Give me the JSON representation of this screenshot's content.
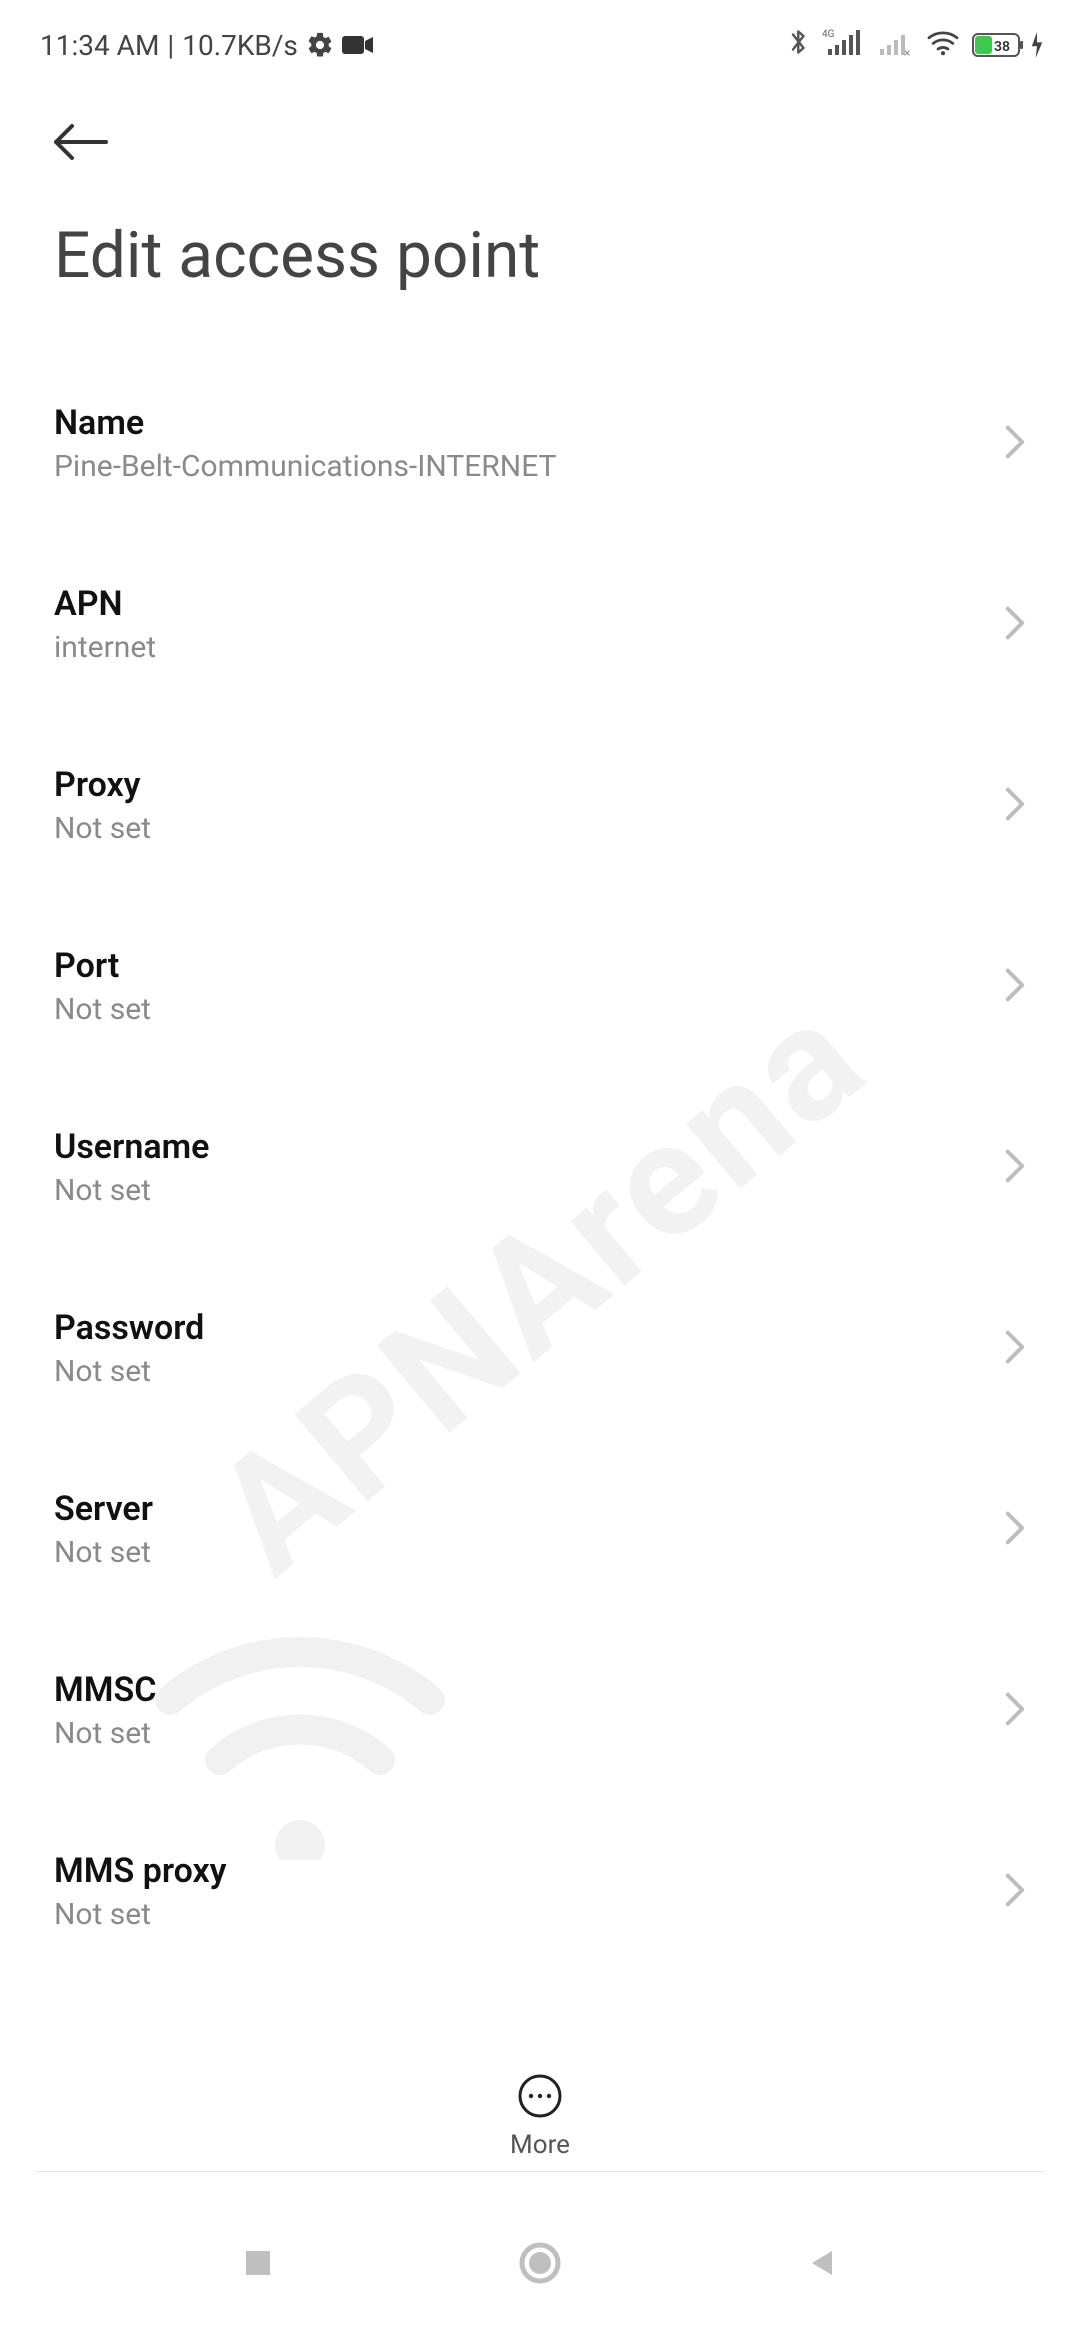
{
  "status": {
    "time": "11:34 AM",
    "speed": "10.7KB/s",
    "network_type": "4G",
    "battery_percent": "38"
  },
  "page": {
    "title": "Edit access point"
  },
  "settings": [
    {
      "label": "Name",
      "value": "Pine-Belt-Communications-INTERNET"
    },
    {
      "label": "APN",
      "value": "internet"
    },
    {
      "label": "Proxy",
      "value": "Not set"
    },
    {
      "label": "Port",
      "value": "Not set"
    },
    {
      "label": "Username",
      "value": "Not set"
    },
    {
      "label": "Password",
      "value": "Not set"
    },
    {
      "label": "Server",
      "value": "Not set"
    },
    {
      "label": "MMSC",
      "value": "Not set"
    },
    {
      "label": "MMS proxy",
      "value": "Not set"
    }
  ],
  "bottom": {
    "more_label": "More"
  },
  "watermark": "APNArena"
}
